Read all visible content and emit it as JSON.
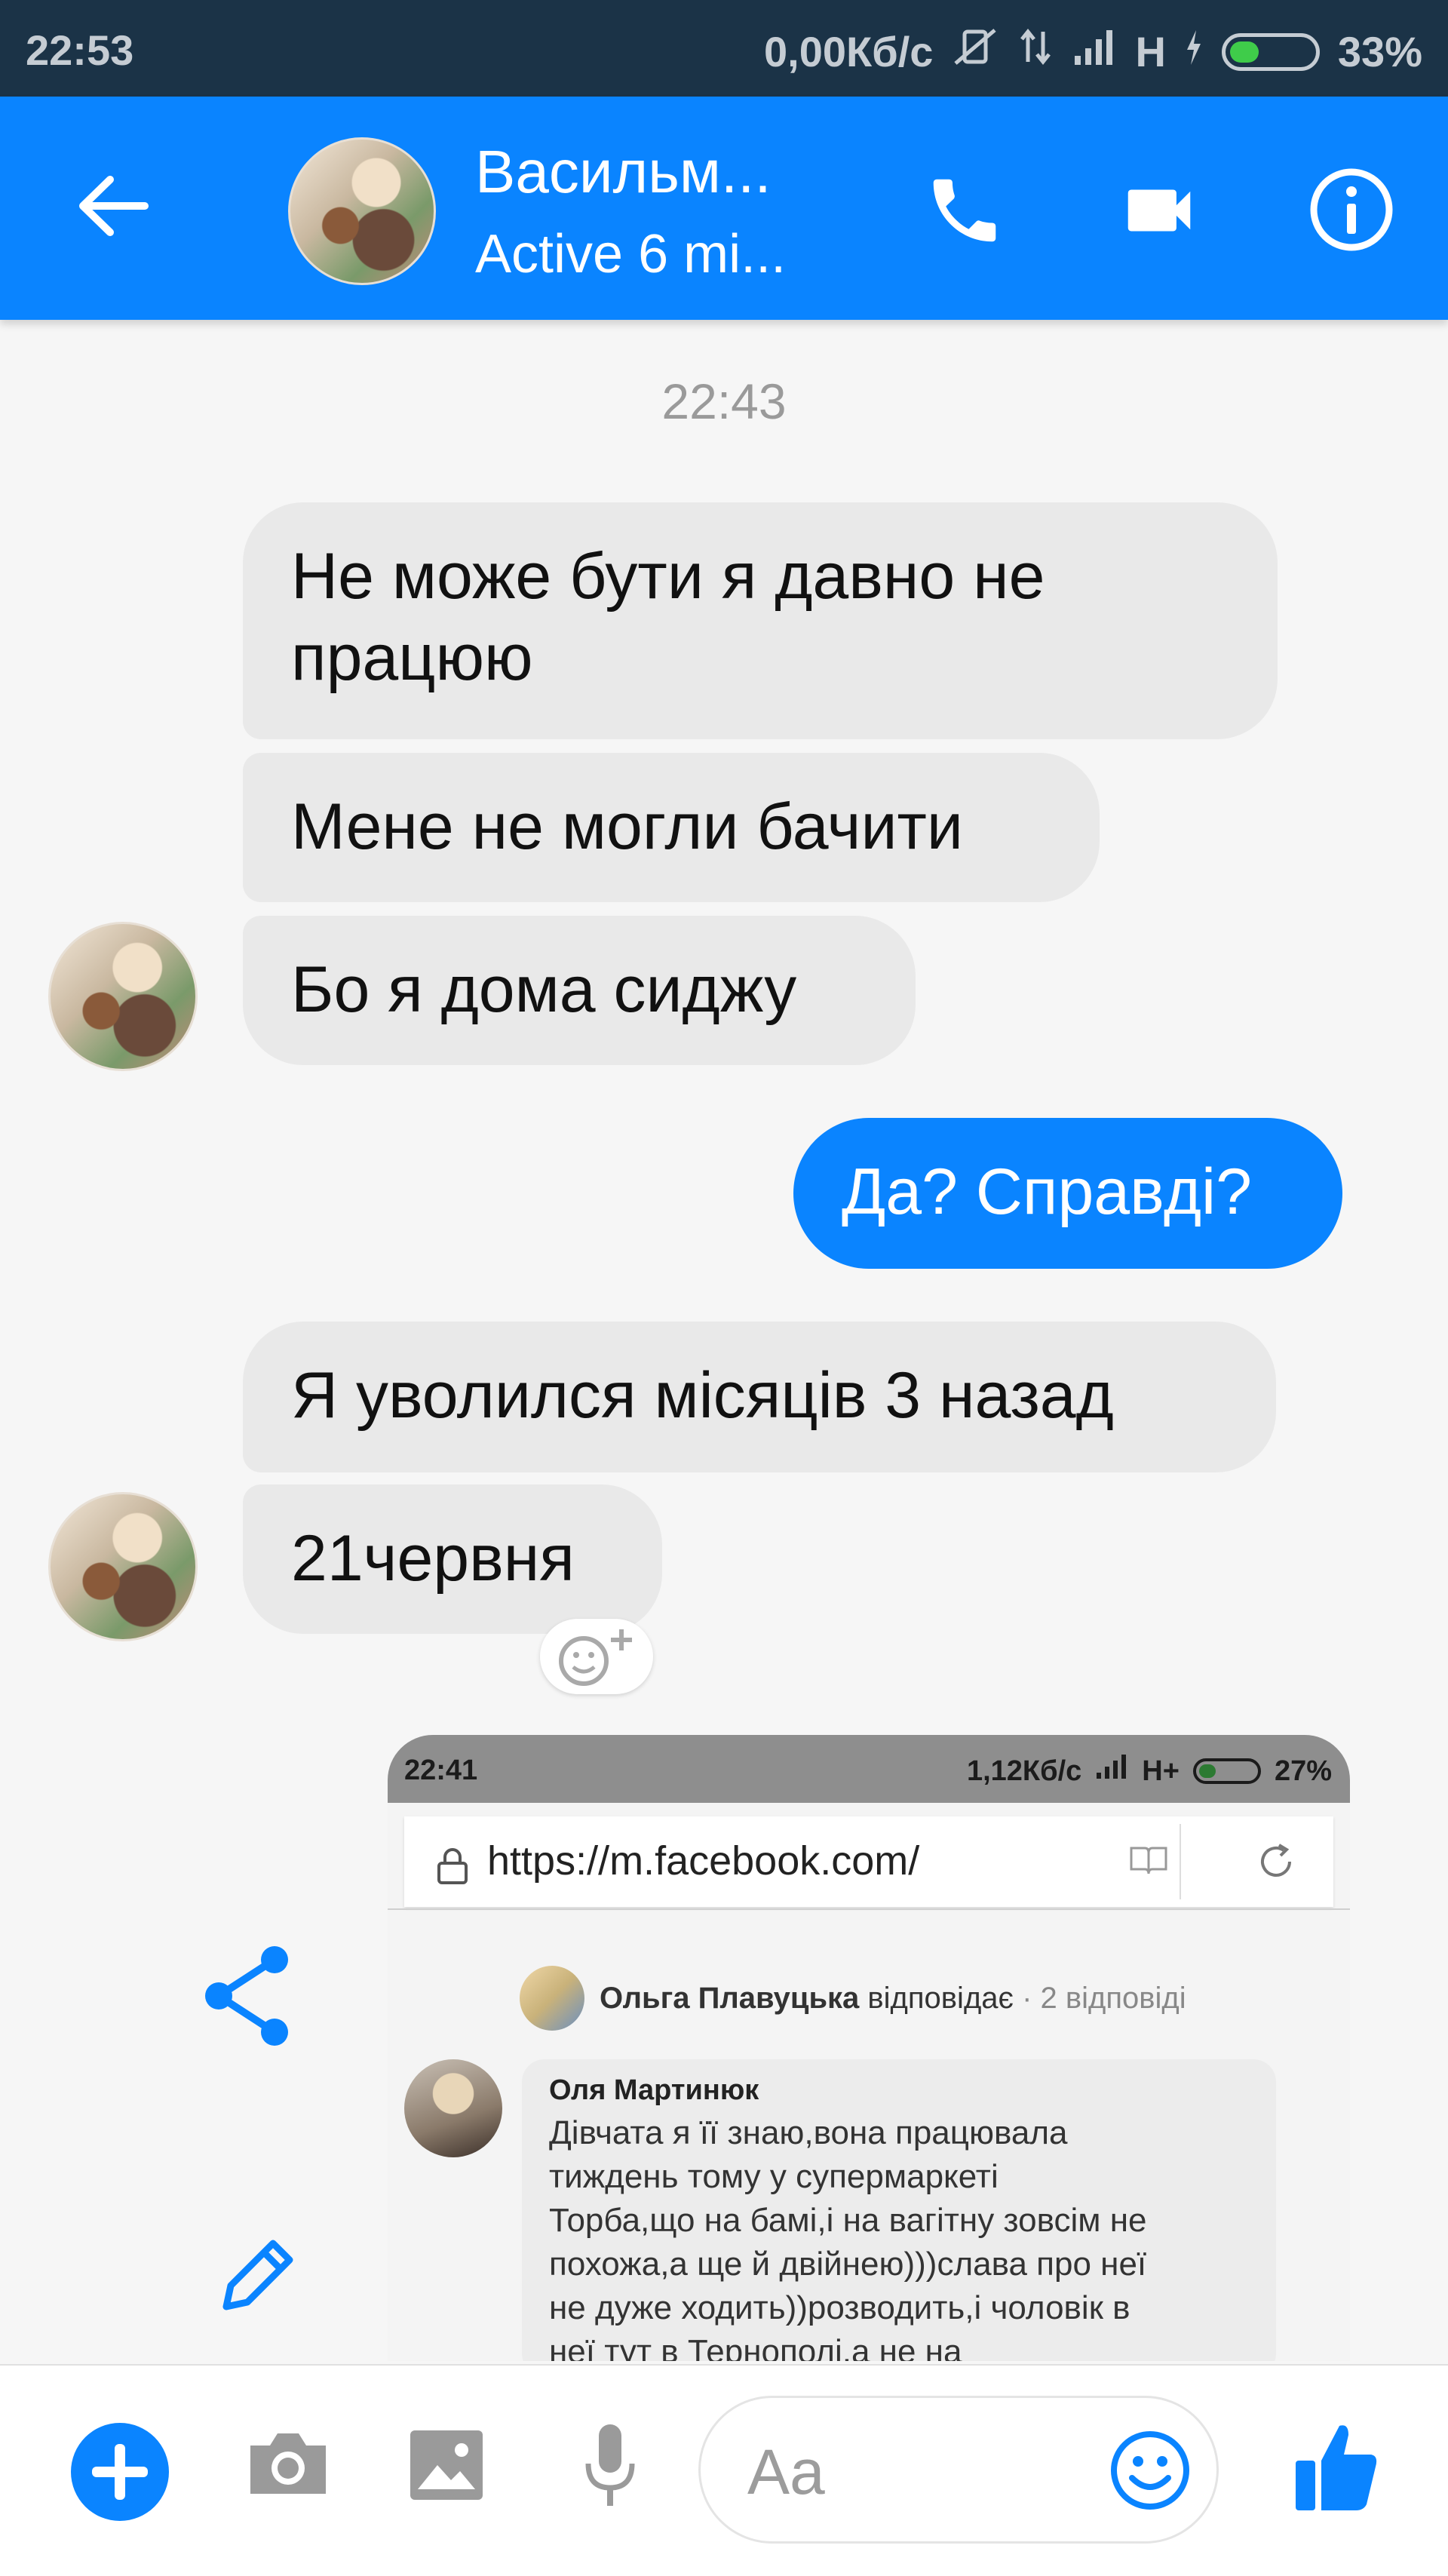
{
  "status_bar": {
    "time": "22:53",
    "speed": "0,00Кб/с",
    "network": "H",
    "battery": "33%",
    "battery_level": 0.33
  },
  "header": {
    "contact_name": "Васильм...",
    "active_status": "Active 6 mi...",
    "icons": [
      "back-arrow-icon",
      "phone-icon",
      "video-camera-icon",
      "info-icon"
    ],
    "accent_color": "#0a84ff"
  },
  "chat": {
    "timestamp": "22:43",
    "messages": [
      {
        "from": "them",
        "text": "Не може бути я давно не працюю"
      },
      {
        "from": "them",
        "text": "Мене не могли бачити"
      },
      {
        "from": "them",
        "text": "Бо я дома сиджу"
      },
      {
        "from": "me",
        "text": "Да? Справді?"
      },
      {
        "from": "them",
        "text": "Я уволился місяців 3 назад"
      },
      {
        "from": "them",
        "text": "21червня"
      }
    ],
    "reaction_icon": "add-reaction-icon"
  },
  "shared_screenshot": {
    "status": {
      "time": "22:41",
      "speed": "1,12Кб/с",
      "network": "H+",
      "battery": "27%"
    },
    "url": "https://m.facebook.com/",
    "reply_line": {
      "name": "Ольга Плавуцька",
      "action": "відповідає",
      "count": "· 2 відповіді"
    },
    "comment": {
      "author": "Оля Мартинюк",
      "text": "Дівчата я її знаю,вона працювала\nтиждень тому у супермаркеті\nТорба,що на бамі,і на вагітну зовсім не\nпохожа,а ще й двійнею)))слава про неї\nне дуже ходить))розводить,і чоловік в\nнеї тут в Тернополі,а не на"
    }
  },
  "side_actions": [
    "share-icon",
    "edit-pencil-icon"
  ],
  "composer": {
    "placeholder": "Aa",
    "icons": [
      "plus-icon",
      "camera-icon",
      "gallery-icon",
      "microphone-icon",
      "emoji-icon",
      "thumbs-up-icon"
    ]
  }
}
